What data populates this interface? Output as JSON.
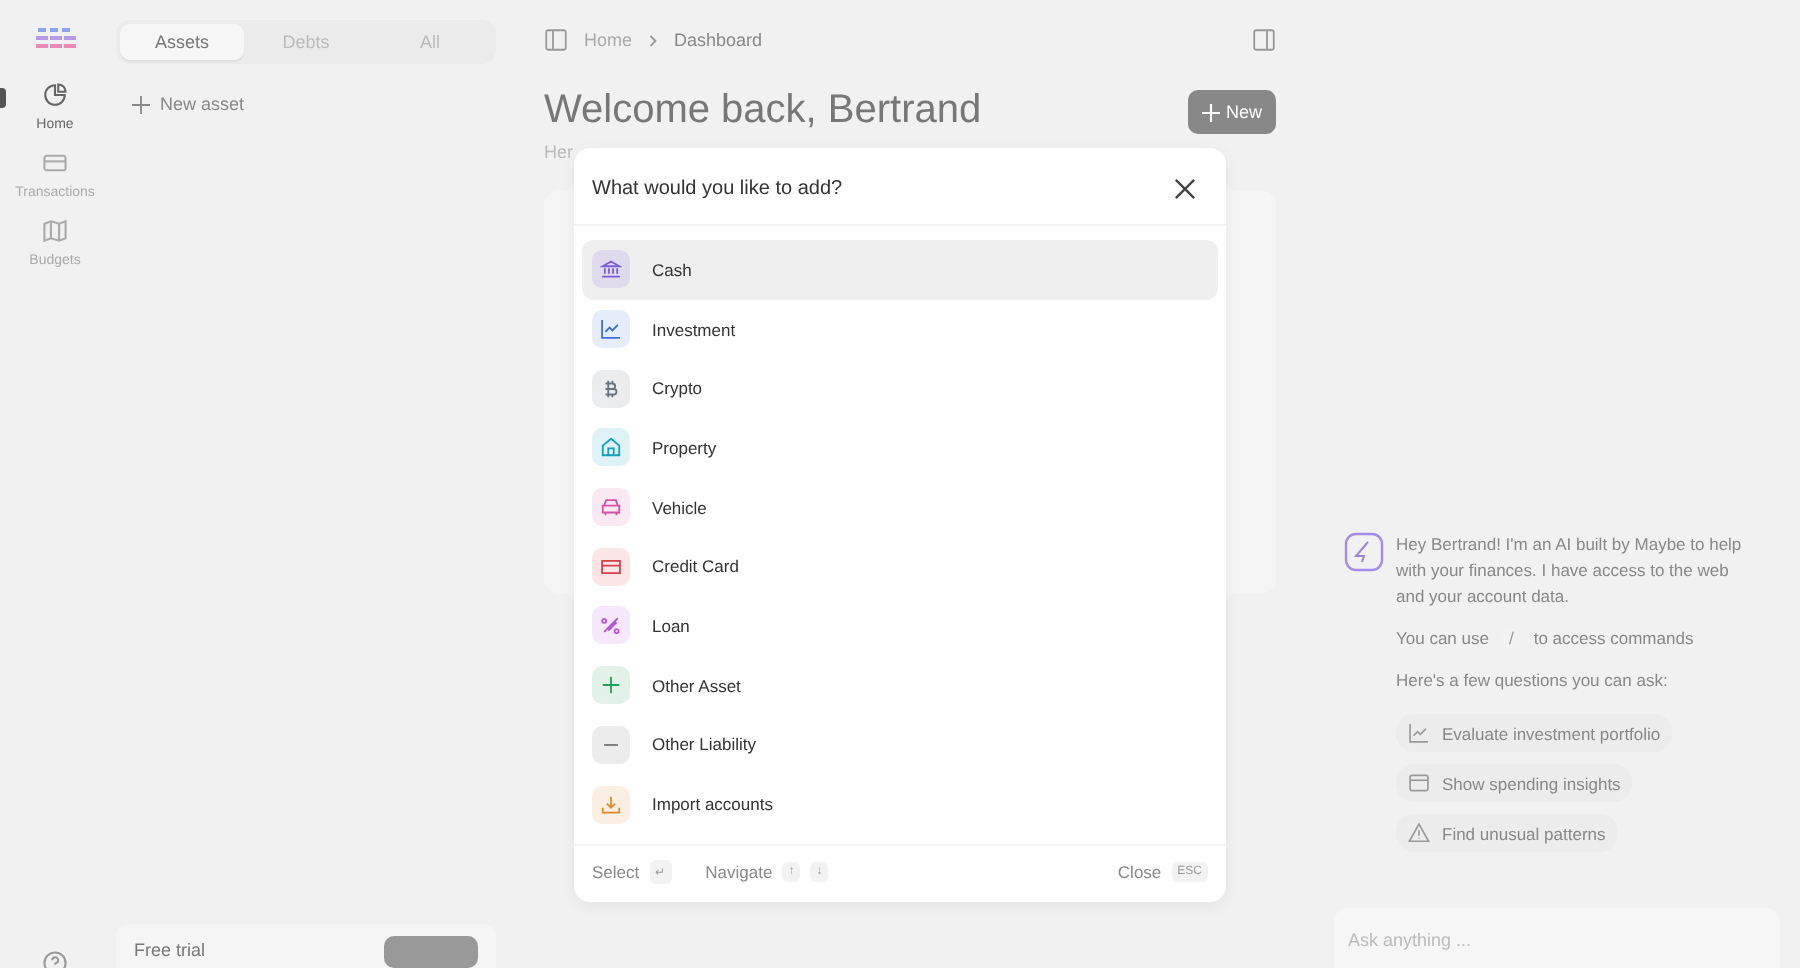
{
  "rail": {
    "items": [
      {
        "label": "Home",
        "selected": true
      },
      {
        "label": "Transactions",
        "selected": false
      },
      {
        "label": "Budgets",
        "selected": false
      }
    ]
  },
  "sidebar": {
    "tabs": [
      {
        "label": "Assets",
        "selected": true
      },
      {
        "label": "Debts",
        "selected": false
      },
      {
        "label": "All",
        "selected": false
      }
    ],
    "new_asset": "New asset",
    "trial": {
      "label": "Free trial"
    }
  },
  "main": {
    "breadcrumb": [
      "Home",
      "Dashboard"
    ],
    "title": "Welcome back, Bertrand",
    "subtitle": "Her",
    "new_button": "New"
  },
  "dialog": {
    "title": "What would you like to add?",
    "options": [
      {
        "label": "Cash",
        "color": "#7c5cd6",
        "selected": true
      },
      {
        "label": "Investment",
        "color": "#3b6fd6",
        "selected": false
      },
      {
        "label": "Crypto",
        "color": "#6b7280",
        "selected": false
      },
      {
        "label": "Property",
        "color": "#0e9fc2",
        "selected": false
      },
      {
        "label": "Vehicle",
        "color": "#d64fa8",
        "selected": false
      },
      {
        "label": "Credit Card",
        "color": "#d93f4a",
        "selected": false
      },
      {
        "label": "Loan",
        "color": "#b84fd6",
        "selected": false
      },
      {
        "label": "Other Asset",
        "color": "#22a05a",
        "selected": false
      },
      {
        "label": "Other Liability",
        "color": "#737373",
        "selected": false
      },
      {
        "label": "Import accounts",
        "color": "#e08a2a",
        "selected": false
      }
    ],
    "footer": {
      "select": "Select",
      "select_key": "↵",
      "navigate": "Navigate",
      "up_key": "↑",
      "down_key": "↓",
      "close": "Close",
      "close_key": "ESC"
    }
  },
  "chat": {
    "intro": "Hey Bertrand! I'm an AI built by Maybe to help with your finances. I have access to the web and your account data.",
    "commands_before": "You can use",
    "commands_key": "/",
    "commands_after": "to access commands",
    "questions_label": "Here's a few questions you can ask:",
    "suggestions": [
      "Evaluate investment portfolio",
      "Show spending insights",
      "Find unusual patterns"
    ],
    "input": {
      "placeholder": "Ask anything ..."
    }
  }
}
